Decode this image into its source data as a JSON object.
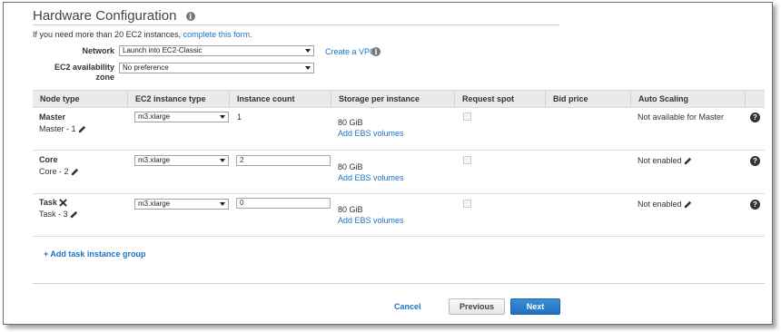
{
  "section": {
    "title": "Hardware Configuration",
    "notice_prefix": "If you need more than 20 EC2 instances,",
    "notice_link": "complete this form."
  },
  "form": {
    "network_label": "Network",
    "network_value": "Launch into EC2-Classic",
    "create_vpc_link": "Create a VPC",
    "az_label_1": "EC2 availability",
    "az_label_2": "zone",
    "az_value": "No preference"
  },
  "table": {
    "headers": [
      "Node type",
      "EC2 instance type",
      "Instance count",
      "Storage per instance",
      "Request spot",
      "Bid price",
      "Auto Scaling"
    ],
    "rows": [
      {
        "node_type": "Master",
        "node_sub": "Master - 1",
        "instance_type": "m3.xlarge",
        "count": "1",
        "storage": "80 GiB",
        "ebs_link": "Add EBS volumes",
        "auto_scaling": "Not available for Master"
      },
      {
        "node_type": "Core",
        "node_sub": "Core - 2",
        "instance_type": "m3.xlarge",
        "count": "2",
        "storage": "80 GiB",
        "ebs_link": "Add EBS volumes",
        "auto_scaling": "Not enabled"
      },
      {
        "node_type": "Task",
        "node_sub": "Task - 3",
        "instance_type": "m3.xlarge",
        "count": "0",
        "storage": "80 GiB",
        "ebs_link": "Add EBS volumes",
        "auto_scaling": "Not enabled"
      }
    ]
  },
  "actions": {
    "add_task": "+ Add task instance group",
    "cancel": "Cancel",
    "previous": "Previous",
    "next": "Next"
  },
  "colors": {
    "link": "#1a73c6",
    "primary_button": "#1f6fbf",
    "header_bg": "#eaeaea"
  },
  "icons": {
    "info": "info-icon",
    "help": "help-icon",
    "edit": "pencil-icon",
    "remove": "close-icon"
  }
}
